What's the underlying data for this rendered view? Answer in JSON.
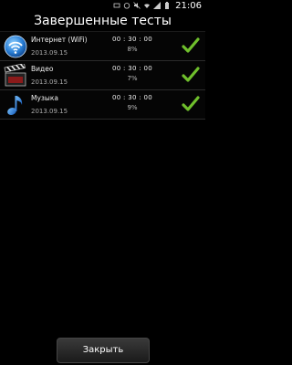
{
  "status_bar": {
    "time": "21:06"
  },
  "title": "Завершенные тесты",
  "rows": [
    {
      "name": "Интернет (WiFi)",
      "date": "2013.09.15",
      "time": "00 : 30 : 00",
      "percent": "8%",
      "icon": "wifi-icon"
    },
    {
      "name": "Видео",
      "date": "2013.09.15",
      "time": "00 : 30 : 00",
      "percent": "7%",
      "icon": "clapperboard-icon"
    },
    {
      "name": "Музыка",
      "date": "2013.09.15",
      "time": "00 : 30 : 00",
      "percent": "9%",
      "icon": "music-note-icon"
    }
  ],
  "close_button": "Закрыть",
  "colors": {
    "check": "#6fbf2c",
    "accent_blue": "#2a7fd6"
  }
}
